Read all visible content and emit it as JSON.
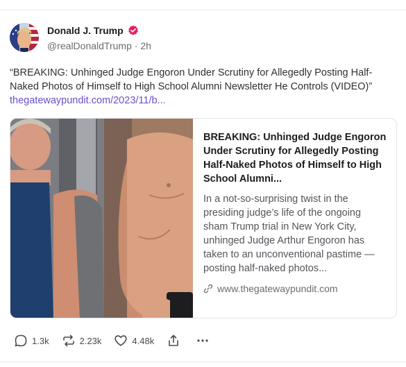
{
  "post": {
    "author": {
      "display_name": "Donald J. Trump",
      "handle": "@realDonaldTrump",
      "separator": "·",
      "time_ago": "2h",
      "verified": true
    },
    "text": "“BREAKING: Unhinged Judge Engoron Under Scrutiny for Allegedly Posting Half-Naked Photos of Himself to High School Alumni Newsletter He Controls (VIDEO)”",
    "link_text": "thegatewaypundit.com/2023/11/b...",
    "link_card": {
      "title": "BREAKING: Unhinged Judge Engoron Under Scrutiny for Allegedly Posting Half-Naked Photos of Himself to High School Alumni...",
      "description": "In a not-so-surprising twist in the presiding judge’s life of the ongoing sham Trump trial in New York City, unhinged Judge Arthur Engoron has taken to an unconventional pastime —posting half-naked photos...",
      "domain": "www.thegatewaypundit.com"
    },
    "actions": {
      "replies": "1.3k",
      "reposts": "2.23k",
      "likes": "4.48k"
    }
  },
  "icons": {
    "reply": "reply-icon",
    "repost": "repost-icon",
    "like": "heart-icon",
    "share": "share-icon",
    "more": "more-icon",
    "link": "link-icon",
    "verified": "verified-badge-icon"
  },
  "colors": {
    "accent_link": "#6b4fc8",
    "verified_badge": "#e0245e"
  }
}
